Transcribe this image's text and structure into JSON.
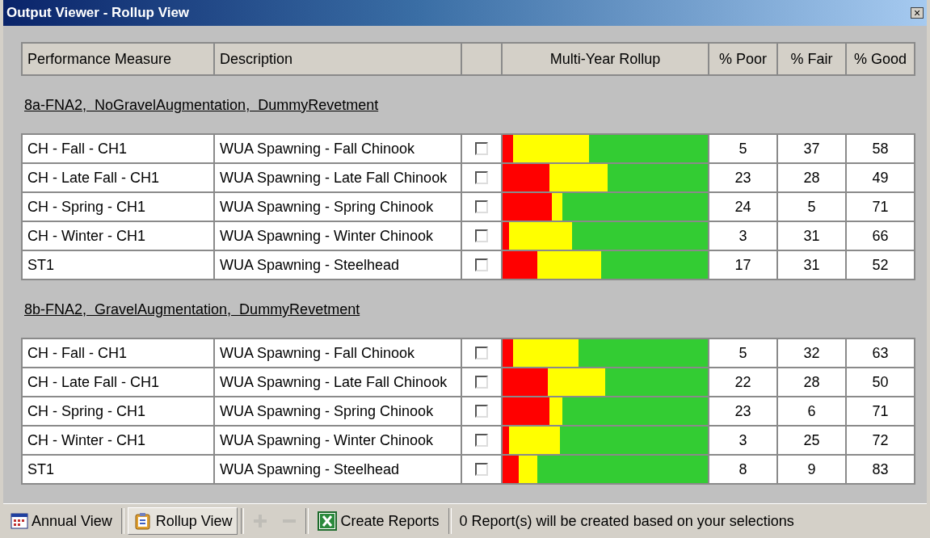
{
  "window": {
    "title": "Output Viewer - Rollup View",
    "close": "×"
  },
  "table": {
    "columns": [
      "Performance Measure",
      "Description",
      "Multi-Year Rollup",
      "% Poor",
      "% Fair",
      "% Good"
    ],
    "groups": [
      {
        "title": "8a-FNA2,  NoGravelAugmentation,  DummyRevetment",
        "rows": [
          {
            "measure": "CH - Fall - CH1",
            "description": "WUA Spawning - Fall Chinook",
            "checked": false,
            "poor": "5",
            "fair": "37",
            "good": "58"
          },
          {
            "measure": "CH - Late Fall - CH1",
            "description": "WUA Spawning - Late Fall Chinook",
            "checked": false,
            "poor": "23",
            "fair": "28",
            "good": "49"
          },
          {
            "measure": "CH - Spring - CH1",
            "description": "WUA Spawning - Spring Chinook",
            "checked": false,
            "poor": "24",
            "fair": "5",
            "good": "71"
          },
          {
            "measure": "CH - Winter - CH1",
            "description": "WUA Spawning - Winter Chinook",
            "checked": false,
            "poor": "3",
            "fair": "31",
            "good": "66"
          },
          {
            "measure": "ST1",
            "description": "WUA Spawning - Steelhead",
            "checked": false,
            "poor": "17",
            "fair": "31",
            "good": "52"
          }
        ]
      },
      {
        "title": "8b-FNA2,  GravelAugmentation,  DummyRevetment",
        "rows": [
          {
            "measure": "CH - Fall - CH1",
            "description": "WUA Spawning - Fall Chinook",
            "checked": false,
            "poor": "5",
            "fair": "32",
            "good": "63"
          },
          {
            "measure": "CH - Late Fall - CH1",
            "description": "WUA Spawning - Late Fall Chinook",
            "checked": false,
            "poor": "22",
            "fair": "28",
            "good": "50"
          },
          {
            "measure": "CH - Spring - CH1",
            "description": "WUA Spawning - Spring Chinook",
            "checked": false,
            "poor": "23",
            "fair": "6",
            "good": "71"
          },
          {
            "measure": "CH - Winter - CH1",
            "description": "WUA Spawning - Winter Chinook",
            "checked": false,
            "poor": "3",
            "fair": "25",
            "good": "72"
          },
          {
            "measure": "ST1",
            "description": "WUA Spawning - Steelhead",
            "checked": false,
            "poor": "8",
            "fair": "9",
            "good": "83"
          }
        ]
      }
    ]
  },
  "toolbar": [
    {
      "kind": "button",
      "label": "Annual View",
      "selected": false
    },
    {
      "kind": "button",
      "label": "Rollup View",
      "selected": true
    },
    {
      "kind": "icon",
      "disabled": true
    },
    {
      "kind": "icon",
      "disabled": true
    },
    {
      "kind": "button",
      "label": "Create Reports",
      "selected": false
    },
    {
      "kind": "status",
      "label": "0 Report(s) will be created based on your selections"
    }
  ]
}
